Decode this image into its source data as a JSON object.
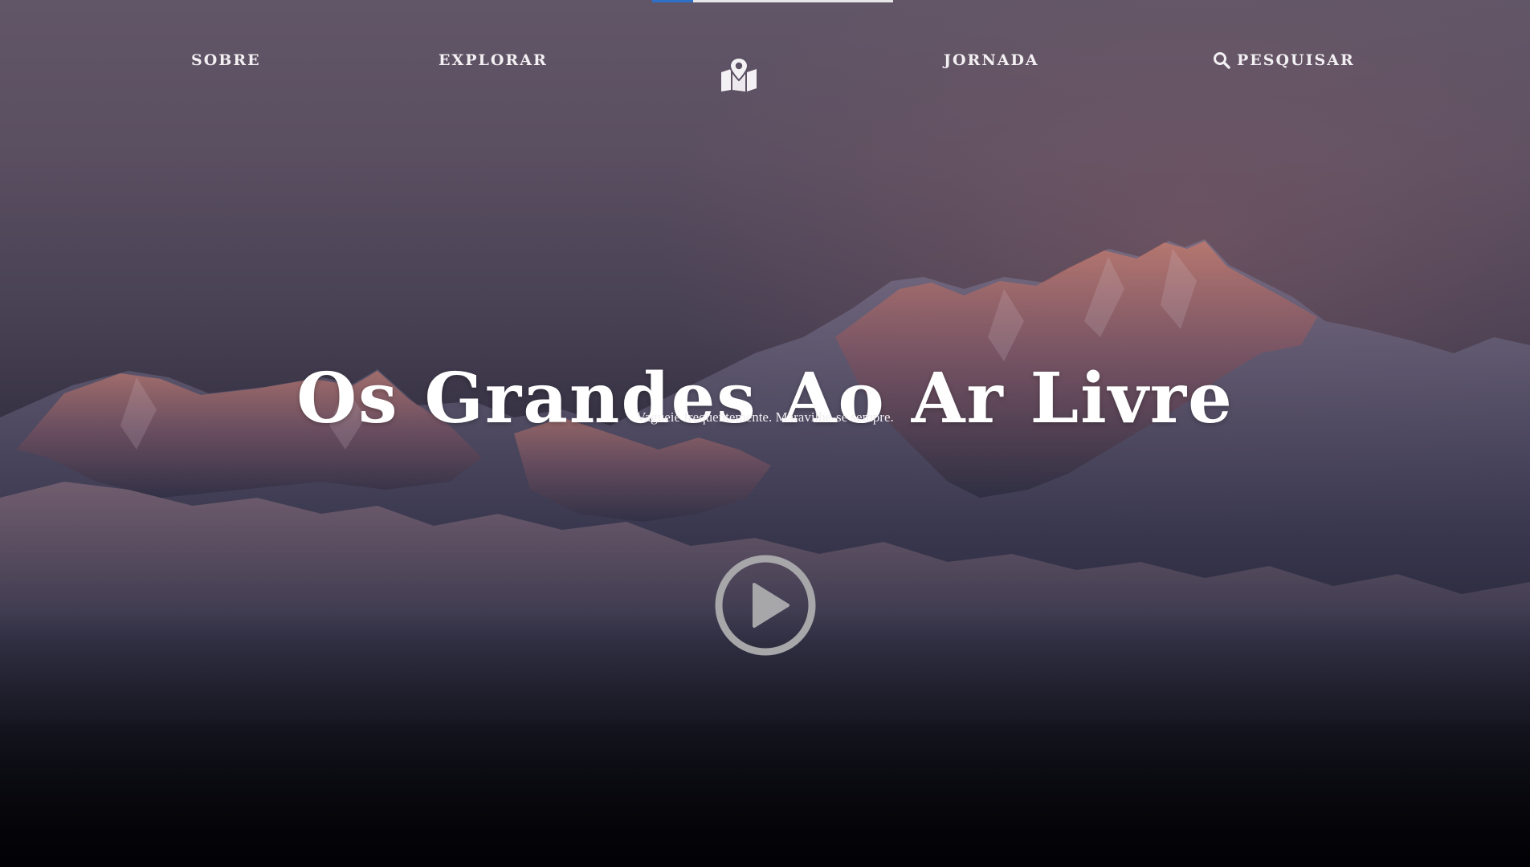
{
  "top_progress": {
    "value": 0.17
  },
  "nav": {
    "items": [
      {
        "label": "SOBRE"
      },
      {
        "label": "EXPLORAR"
      },
      {
        "label": "JORNADA"
      },
      {
        "label": "PESQUISAR",
        "icon": "search-icon"
      }
    ],
    "logo_icon": "map-marker-icon"
  },
  "hero": {
    "title": "Os Grandes Ao Ar Livre",
    "subtitle": "Vagueie frequentemente. Maravilhe-se sempre.",
    "play_icon": "play-circle-icon"
  },
  "colors": {
    "progress_accent": "#2f6fc8",
    "text": "#ffffff",
    "sky_top": "#615667",
    "alpenglow": "#c97869",
    "bottom": "#020205"
  }
}
